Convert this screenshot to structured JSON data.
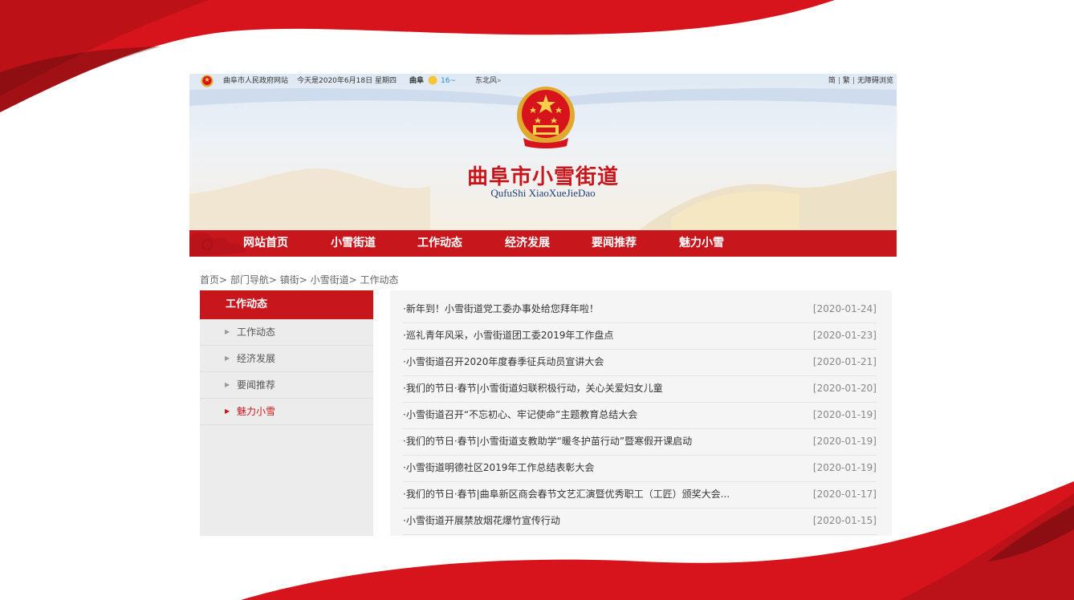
{
  "topbar": {
    "site_name": "曲阜市人民政府网站",
    "today": "今天是2020年6月18日 星期四",
    "city": "曲阜",
    "temp": "16~",
    "wind": "东北风",
    "wind_arrow": "»",
    "link_simplified": "简",
    "link_traditional": "繁",
    "link_accessible": "无障碍浏览",
    "separator": "|"
  },
  "banner": {
    "title": "曲阜市小雪街道",
    "subtitle": "QufuShi XiaoXueJieDao"
  },
  "nav": {
    "items": [
      {
        "label": "网站首页"
      },
      {
        "label": "小雪街道"
      },
      {
        "label": "工作动态"
      },
      {
        "label": "经济发展"
      },
      {
        "label": "要闻推荐"
      },
      {
        "label": "魅力小雪"
      }
    ]
  },
  "breadcrumb": "首页> 部门导航> 镇街> 小雪街道> 工作动态",
  "sidebar": {
    "title": "工作动态",
    "items": [
      {
        "label": "工作动态"
      },
      {
        "label": "经济发展"
      },
      {
        "label": "要闻推荐"
      },
      {
        "label": "魅力小雪"
      }
    ],
    "arrow": "▶"
  },
  "news": [
    {
      "title": "·新年到！小雪街道党工委办事处给您拜年啦！",
      "date": "[2020-01-24]"
    },
    {
      "title": "·巡礼青年风采，小雪街道团工委2019年工作盘点",
      "date": "[2020-01-23]"
    },
    {
      "title": "·小雪街道召开2020年度春季征兵动员宣讲大会",
      "date": "[2020-01-21]"
    },
    {
      "title": "·我们的节日·春节|小雪街道妇联积极行动，关心关爱妇女儿童",
      "date": "[2020-01-20]"
    },
    {
      "title": "·小雪街道召开“不忘初心、牢记使命”主题教育总结大会",
      "date": "[2020-01-19]"
    },
    {
      "title": "·我们的节日·春节|小雪街道支教助学“暖冬护苗行动”暨寒假开课启动",
      "date": "[2020-01-19]"
    },
    {
      "title": "·小雪街道明德社区2019年工作总结表彰大会",
      "date": "[2020-01-19]"
    },
    {
      "title": "·我们的节日·春节|曲阜新区商会春节文艺汇演暨优秀职工（工匠）颁奖大会...",
      "date": "[2020-01-17]"
    },
    {
      "title": "·小雪街道开展禁放烟花爆竹宣传行动",
      "date": "[2020-01-15]"
    }
  ],
  "colors": {
    "brand_red": "#c8161d",
    "sidebar_bg": "#ececec",
    "list_bg": "#f5f5f5"
  }
}
